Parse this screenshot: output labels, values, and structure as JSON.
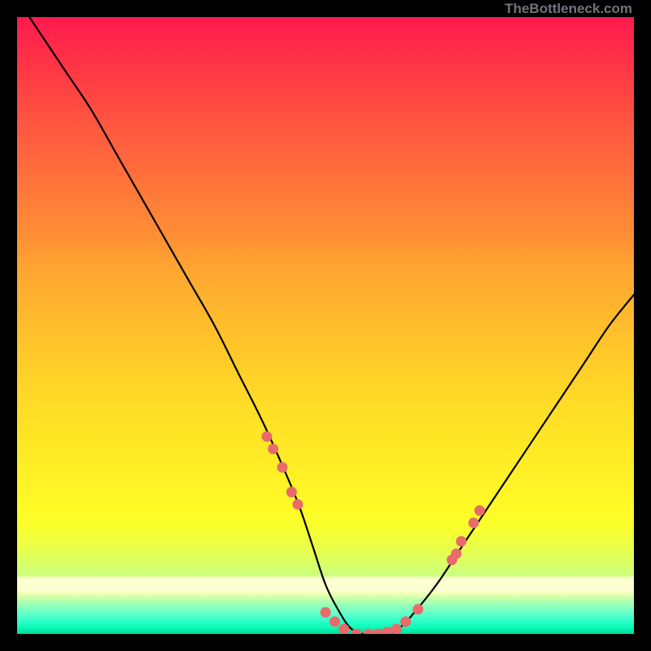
{
  "watermark": "TheBottleneck.com",
  "colors": {
    "page_bg": "#000000",
    "curve_stroke": "#000000",
    "marker_fill": "#e86a6a",
    "marker_stroke": "#d85858"
  },
  "chart_data": {
    "type": "line",
    "title": "",
    "xlabel": "",
    "ylabel": "",
    "xlim": [
      0,
      100
    ],
    "ylim": [
      0,
      100
    ],
    "series": [
      {
        "name": "bottleneck-curve",
        "x": [
          2,
          4,
          8,
          12,
          16,
          20,
          24,
          28,
          32,
          36,
          40,
          44,
          46,
          48,
          50,
          52,
          54,
          56,
          58,
          60,
          62,
          64,
          68,
          72,
          76,
          80,
          84,
          88,
          92,
          96,
          100
        ],
        "y": [
          100,
          97,
          91,
          85,
          78,
          71,
          64,
          57,
          50,
          42,
          34,
          25,
          20,
          14,
          8,
          4,
          1,
          0,
          0,
          0,
          1,
          3,
          8,
          14,
          20,
          26,
          32,
          38,
          44,
          50,
          55
        ]
      }
    ],
    "markers": {
      "name": "highlight-dots",
      "points": [
        {
          "x": 40.5,
          "y": 32
        },
        {
          "x": 41.5,
          "y": 30
        },
        {
          "x": 43.0,
          "y": 27
        },
        {
          "x": 44.5,
          "y": 23
        },
        {
          "x": 45.5,
          "y": 21
        },
        {
          "x": 50.0,
          "y": 3.5
        },
        {
          "x": 51.5,
          "y": 2.0
        },
        {
          "x": 53.0,
          "y": 0.8
        },
        {
          "x": 55.0,
          "y": 0.0
        },
        {
          "x": 57.0,
          "y": 0.0
        },
        {
          "x": 58.5,
          "y": 0.0
        },
        {
          "x": 60.0,
          "y": 0.3
        },
        {
          "x": 61.5,
          "y": 0.8
        },
        {
          "x": 63.0,
          "y": 2.0
        },
        {
          "x": 65.0,
          "y": 4.0
        },
        {
          "x": 70.5,
          "y": 12
        },
        {
          "x": 71.2,
          "y": 13
        },
        {
          "x": 72.0,
          "y": 15
        },
        {
          "x": 74.0,
          "y": 18
        },
        {
          "x": 75.0,
          "y": 20
        }
      ]
    }
  }
}
